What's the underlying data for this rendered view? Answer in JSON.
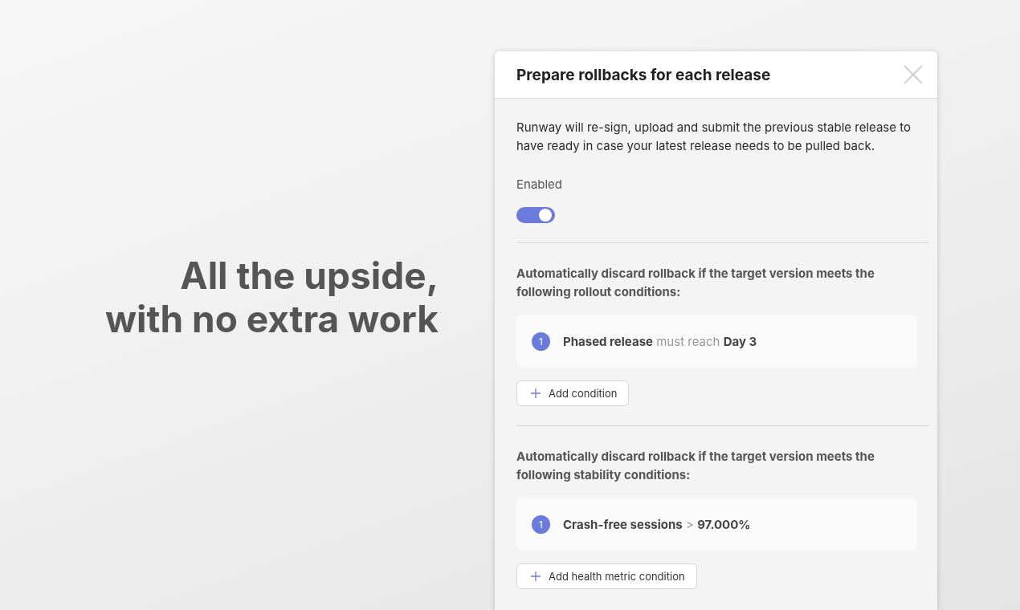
{
  "headline": [
    "All the upside,",
    "with no extra work"
  ],
  "dialog": {
    "title": "Prepare rollbacks for each release",
    "description": "Runway will re-sign, upload and submit the previous stable release to have ready in case your latest release needs to be pulled back.",
    "toggle": {
      "label": "Enabled",
      "on": true
    },
    "sections": [
      {
        "heading": "Automatically discard rollback if the target version meets the following rollout conditions:",
        "conditions": [
          {
            "number": "1",
            "text": "**Phased release** must reach **Day 3**"
          }
        ],
        "button": "Add condition"
      },
      {
        "heading": "Automatically discard rollback if the target version meets the following stability conditions:",
        "conditions": [
          {
            "number": "1",
            "text": "**Crash-free sessions** > **97.000%**"
          }
        ],
        "button": "Add health metric condition"
      }
    ]
  }
}
